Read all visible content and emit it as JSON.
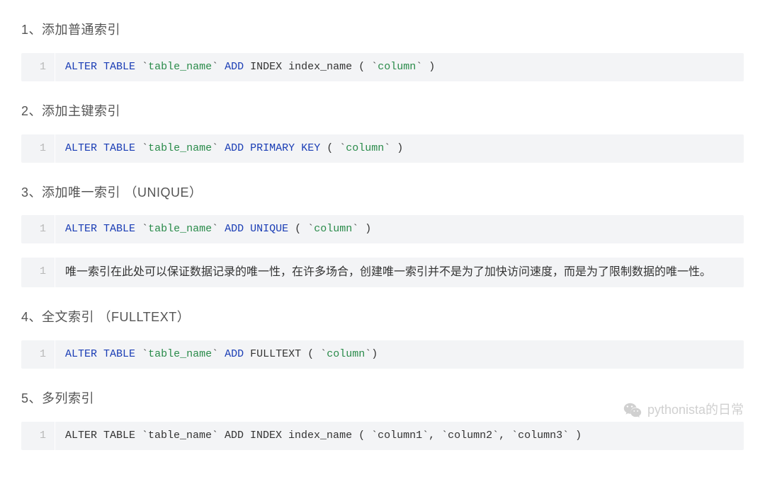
{
  "sections": [
    {
      "heading": "1、添加普通索引",
      "code": {
        "lineno": "1",
        "tokens": [
          {
            "cls": "kw",
            "t": "ALTER"
          },
          {
            "cls": "plain",
            "t": " "
          },
          {
            "cls": "kw",
            "t": "TABLE"
          },
          {
            "cls": "plain",
            "t": " "
          },
          {
            "cls": "back-tick",
            "t": "`"
          },
          {
            "cls": "ident",
            "t": "table_name"
          },
          {
            "cls": "back-tick",
            "t": "`"
          },
          {
            "cls": "plain",
            "t": " "
          },
          {
            "cls": "kw",
            "t": "ADD"
          },
          {
            "cls": "plain",
            "t": " INDEX index_name ( "
          },
          {
            "cls": "back-tick",
            "t": "`"
          },
          {
            "cls": "ident",
            "t": "column"
          },
          {
            "cls": "back-tick",
            "t": "`"
          },
          {
            "cls": "plain",
            "t": " )"
          }
        ]
      }
    },
    {
      "heading": "2、添加主键索引",
      "code": {
        "lineno": "1",
        "tokens": [
          {
            "cls": "kw",
            "t": "ALTER"
          },
          {
            "cls": "plain",
            "t": " "
          },
          {
            "cls": "kw",
            "t": "TABLE"
          },
          {
            "cls": "plain",
            "t": " "
          },
          {
            "cls": "back-tick",
            "t": "`"
          },
          {
            "cls": "ident",
            "t": "table_name"
          },
          {
            "cls": "back-tick",
            "t": "`"
          },
          {
            "cls": "plain",
            "t": " "
          },
          {
            "cls": "kw",
            "t": "ADD"
          },
          {
            "cls": "plain",
            "t": " "
          },
          {
            "cls": "kw",
            "t": "PRIMARY"
          },
          {
            "cls": "plain",
            "t": " "
          },
          {
            "cls": "kw",
            "t": "KEY"
          },
          {
            "cls": "plain",
            "t": " ( "
          },
          {
            "cls": "back-tick",
            "t": "`"
          },
          {
            "cls": "ident",
            "t": "column"
          },
          {
            "cls": "back-tick",
            "t": "`"
          },
          {
            "cls": "plain",
            "t": " )"
          }
        ]
      }
    },
    {
      "heading": "3、添加唯一索引 （UNIQUE）",
      "code": {
        "lineno": "1",
        "tokens": [
          {
            "cls": "kw",
            "t": "ALTER"
          },
          {
            "cls": "plain",
            "t": " "
          },
          {
            "cls": "kw",
            "t": "TABLE"
          },
          {
            "cls": "plain",
            "t": " "
          },
          {
            "cls": "back-tick",
            "t": "`"
          },
          {
            "cls": "ident",
            "t": "table_name"
          },
          {
            "cls": "back-tick",
            "t": "`"
          },
          {
            "cls": "plain",
            "t": " "
          },
          {
            "cls": "kw",
            "t": "ADD"
          },
          {
            "cls": "plain",
            "t": " "
          },
          {
            "cls": "kw",
            "t": "UNIQUE"
          },
          {
            "cls": "plain",
            "t": " ( "
          },
          {
            "cls": "back-tick",
            "t": "`"
          },
          {
            "cls": "ident",
            "t": "column"
          },
          {
            "cls": "back-tick",
            "t": "`"
          },
          {
            "cls": "plain",
            "t": " )"
          }
        ]
      },
      "note": {
        "lineno": "1",
        "text": "唯一索引在此处可以保证数据记录的唯一性，在许多场合，创建唯一索引并不是为了加快访问速度，而是为了限制数据的唯一性。"
      }
    },
    {
      "heading": "4、全文索引 （FULLTEXT）",
      "code": {
        "lineno": "1",
        "tokens": [
          {
            "cls": "kw",
            "t": "ALTER"
          },
          {
            "cls": "plain",
            "t": " "
          },
          {
            "cls": "kw",
            "t": "TABLE"
          },
          {
            "cls": "plain",
            "t": " "
          },
          {
            "cls": "back-tick",
            "t": "`"
          },
          {
            "cls": "ident",
            "t": "table_name"
          },
          {
            "cls": "back-tick",
            "t": "`"
          },
          {
            "cls": "plain",
            "t": " "
          },
          {
            "cls": "kw",
            "t": "ADD"
          },
          {
            "cls": "plain",
            "t": " FULLTEXT ( "
          },
          {
            "cls": "back-tick",
            "t": "`"
          },
          {
            "cls": "ident",
            "t": "column"
          },
          {
            "cls": "back-tick",
            "t": "`"
          },
          {
            "cls": "plain",
            "t": ")"
          }
        ]
      }
    },
    {
      "heading": "5、多列索引",
      "code": {
        "lineno": "1",
        "tokens": [
          {
            "cls": "plain",
            "t": "ALTER TABLE `table_name` ADD INDEX index_name ( `column1`, `column2`, `column3` )"
          }
        ]
      }
    }
  ],
  "watermark": {
    "text": "pythonista的日常"
  }
}
